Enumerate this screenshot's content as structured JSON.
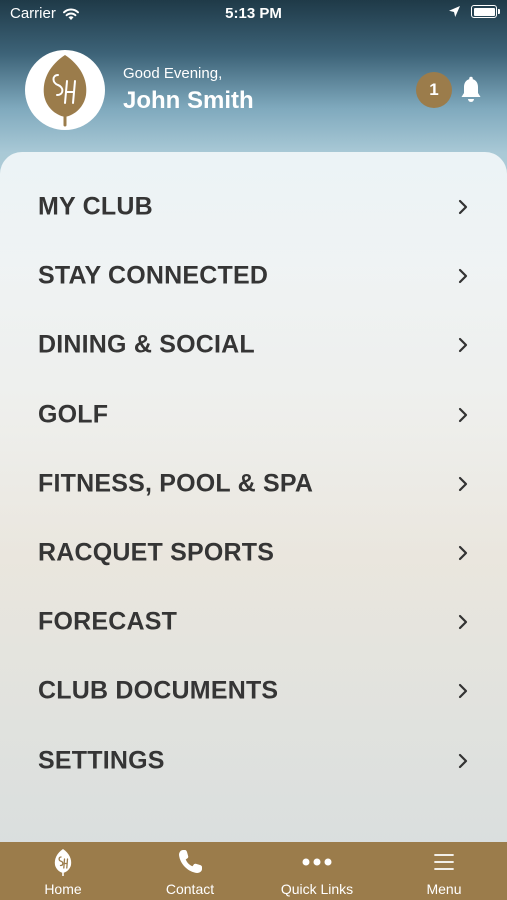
{
  "status_bar": {
    "carrier": "Carrier",
    "time": "5:13 PM"
  },
  "header": {
    "logo_icon": "club-logo-leaf-icon",
    "greeting": "Good Evening,",
    "user_name": "John Smith",
    "notification_count": "1"
  },
  "menu": {
    "items": [
      {
        "label": "MY CLUB"
      },
      {
        "label": "STAY CONNECTED"
      },
      {
        "label": "DINING & SOCIAL"
      },
      {
        "label": "GOLF"
      },
      {
        "label": "FITNESS, POOL & SPA"
      },
      {
        "label": "RACQUET SPORTS"
      },
      {
        "label": "FORECAST"
      },
      {
        "label": "CLUB DOCUMENTS"
      },
      {
        "label": "SETTINGS"
      }
    ]
  },
  "tab_bar": {
    "tabs": [
      {
        "label": "Home",
        "icon": "home-leaf-icon"
      },
      {
        "label": "Contact",
        "icon": "phone-icon"
      },
      {
        "label": "Quick Links",
        "icon": "more-dots-icon"
      },
      {
        "label": "Menu",
        "icon": "hamburger-menu-icon"
      }
    ]
  },
  "colors": {
    "accent": "#9b7c4b",
    "text": "#353535"
  }
}
